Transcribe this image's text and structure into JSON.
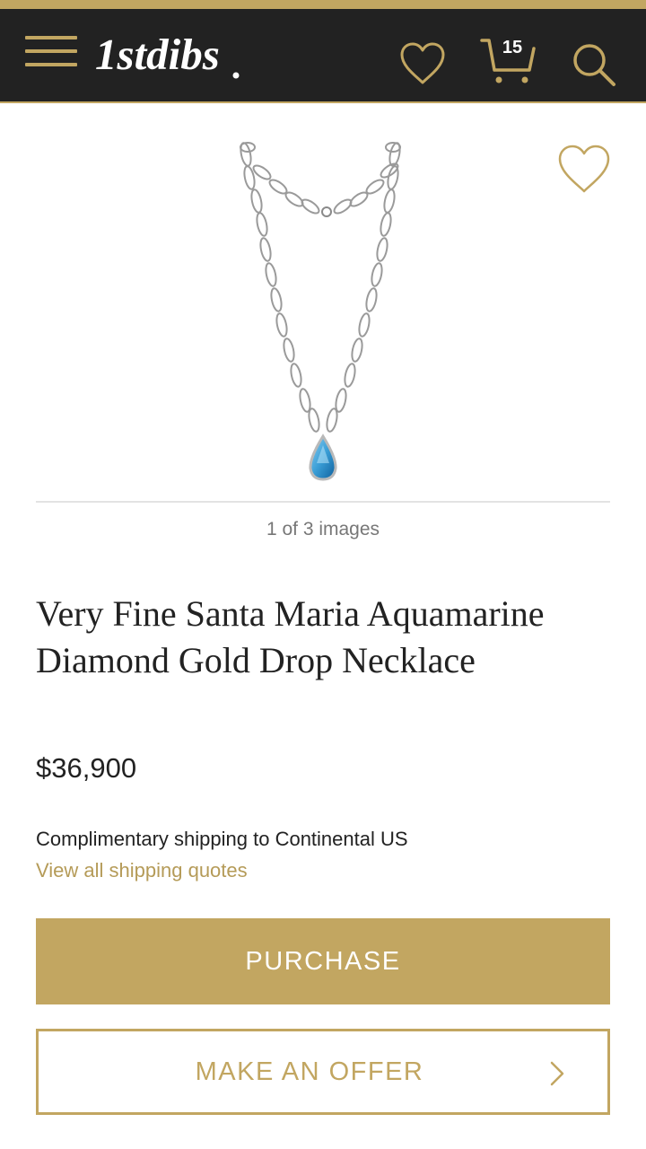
{
  "header": {
    "logo_text": "1stdibs",
    "cart_count": "15",
    "icons": [
      "menu-icon",
      "heart-icon",
      "cart-icon",
      "search-icon"
    ]
  },
  "gallery": {
    "image_alt": "Very Fine Santa Maria Aquamarine Diamond Gold Drop Necklace",
    "counter": "1 of 3 images"
  },
  "product": {
    "title": "Very Fine Santa Maria Aquamarine Diamond Gold Drop Necklace",
    "price": "$36,900",
    "shipping_text": "Complimentary shipping to Continental US",
    "shipping_link": "View all shipping quotes"
  },
  "actions": {
    "purchase_label": "PURCHASE",
    "offer_label": "MAKE AN OFFER"
  },
  "colors": {
    "gold": "#c2a661",
    "header_bg": "#222222",
    "stone": "#3a9ed6"
  }
}
